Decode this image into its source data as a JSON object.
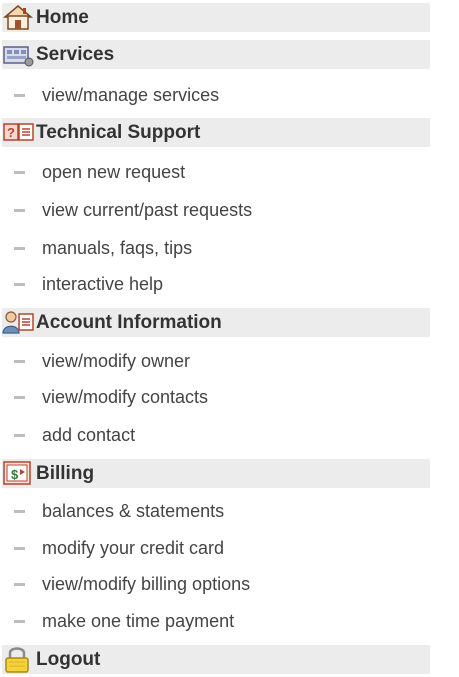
{
  "menu": {
    "home": "Home",
    "services": {
      "title": "Services",
      "items": [
        "view/manage services"
      ]
    },
    "support": {
      "title": "Technical Support",
      "items": [
        "open new request",
        "view current/past requests",
        "manuals, faqs, tips",
        "interactive help"
      ]
    },
    "account": {
      "title": "Account Information",
      "items": [
        "view/modify owner",
        "view/modify contacts",
        "add contact"
      ]
    },
    "billing": {
      "title": "Billing",
      "items": [
        "balances & statements",
        "modify your credit card",
        "view/modify billing options",
        "make one time payment"
      ]
    },
    "logout": "Logout"
  },
  "icons": [
    "house-icon",
    "services-icon",
    "support-icon",
    "account-icon",
    "billing-icon",
    "lock-icon"
  ],
  "colors": {
    "header_bg": "#ececec",
    "header_text": "#333333",
    "item_text": "#444444",
    "dash": "#bdbdbd"
  }
}
